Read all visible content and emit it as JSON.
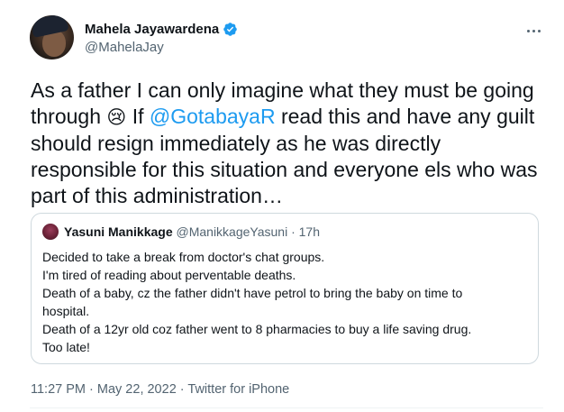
{
  "author": {
    "name": "Mahela Jayawardena",
    "handle": "@MahelaJay",
    "verified": true
  },
  "tweet": {
    "part1": "As a father I can only imagine what they must be going through ",
    "emoji": "😢",
    "part2": " If ",
    "mention": "@GotabayaR",
    "part3": " read this and have any guilt should resign immediately as he was directly responsible for this situation and everyone els who was part of this administration…"
  },
  "quoted": {
    "name": "Yasuni Manikkage",
    "handle": "@ManikkageYasuni",
    "separator": " · ",
    "time": "17h",
    "lines": [
      "Decided to take a break from doctor's chat groups.",
      "I'm tired of reading about perventable deaths.",
      "Death of a baby, cz the father didn't have petrol to bring the baby on time to",
      "hospital.",
      "Death of a 12yr old coz father went to 8 pharmacies to buy a life saving drug.",
      "Too late!"
    ]
  },
  "footer": {
    "time": "11:27 PM",
    "sep1": " · ",
    "date": "May 22, 2022",
    "sep2": " · ",
    "source": "Twitter for iPhone"
  },
  "colors": {
    "accent": "#1d9bf0",
    "text": "#0f1419",
    "muted": "#536471",
    "border": "#cfd9de"
  },
  "icons": {
    "verified": "verified-badge-icon",
    "more": "more-options-icon"
  }
}
